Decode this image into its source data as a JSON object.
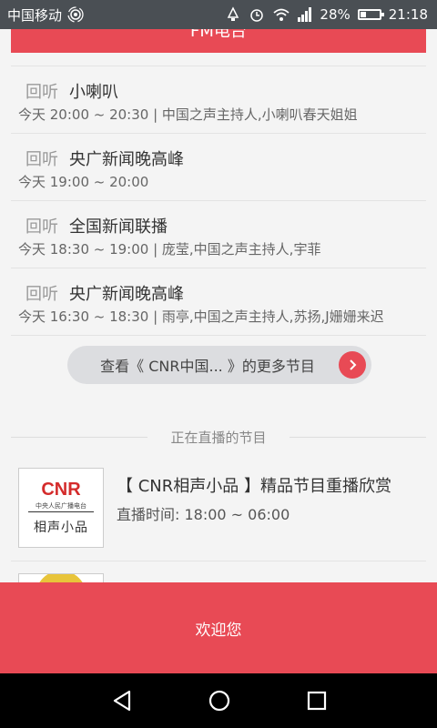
{
  "status_bar": {
    "carrier": "中国移动",
    "battery": "28%",
    "time": "21:18",
    "battery_level": 0.28
  },
  "header": {
    "title": "FM电台"
  },
  "program_list": [
    {
      "replay": "回听",
      "name": "小喇叭",
      "detail": "今天 20:00 ~ 20:30 | 中国之声主持人,小喇叭春天姐姐"
    },
    {
      "replay": "回听",
      "name": "央广新闻晚高峰",
      "detail": "今天 19:00 ~ 20:00"
    },
    {
      "replay": "回听",
      "name": "全国新闻联播",
      "detail": "今天 18:30 ~ 19:00 | 庞莹,中国之声主持人,宇菲"
    },
    {
      "replay": "回听",
      "name": "央广新闻晚高峰",
      "detail": "今天 16:30 ~ 18:30 | 雨亭,中国之声主持人,苏扬,J姗姗来迟"
    }
  ],
  "more_button": {
    "label": "查看《  CNR中国...  》的更多节目"
  },
  "live_section": {
    "heading": "正在直播的节目",
    "card": {
      "logo_brand": "CNR",
      "logo_sub": "中央人民广播电台",
      "logo_category": "相声小品",
      "title": "【 CNR相声小品 】精品节目重播欣赏",
      "time": "直播时间: 18:00 ~ 06:00"
    }
  },
  "welcome": {
    "label": "欢迎您"
  },
  "colors": {
    "accent": "#e84a55",
    "status_bar": "#4a4f54",
    "nav_bar": "#000000"
  }
}
